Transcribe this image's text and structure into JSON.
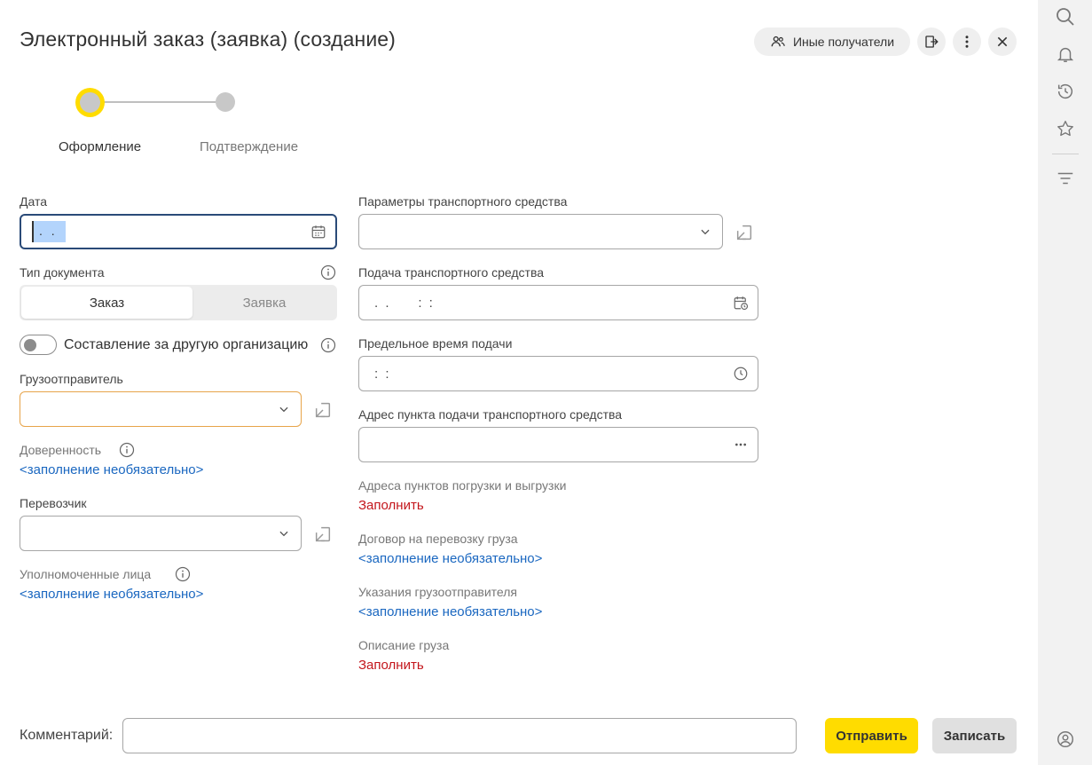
{
  "header": {
    "title": "Электронный заказ (заявка) (создание)",
    "other_recipients": "Иные получатели"
  },
  "steps": [
    {
      "label": "Оформление",
      "active": true
    },
    {
      "label": "Подтверждение",
      "active": false
    }
  ],
  "left": {
    "date_label": "Дата",
    "date_value": ". .",
    "doc_type_label": "Тип документа",
    "doc_type_options": [
      "Заказ",
      "Заявка"
    ],
    "doc_type_selected": "Заказ",
    "other_org_label": "Составление за другую организацию",
    "shipper_label": "Грузоотправитель",
    "power_of_attorney_label": "Доверенность",
    "power_of_attorney_link": "<заполнение необязательно>",
    "carrier_label": "Перевозчик",
    "authorized_label": "Уполномоченные лица",
    "authorized_link": "<заполнение необязательно>"
  },
  "right": {
    "vehicle_params_label": "Параметры транспортного средства",
    "vehicle_supply_label": "Подача транспортного средства",
    "vehicle_supply_value": ". .     : :",
    "deadline_label": "Предельное время подачи",
    "deadline_value": ": :",
    "supply_address_label": "Адрес пункта подачи транспортного средства",
    "loading_addresses_label": "Адреса пунктов погрузки и выгрузки",
    "loading_addresses_link": "Заполнить",
    "contract_label": "Договор на перевозку груза",
    "contract_link": "<заполнение необязательно>",
    "shipper_instructions_label": "Указания грузоотправителя",
    "shipper_instructions_link": "<заполнение необязательно>",
    "cargo_description_label": "Описание груза",
    "cargo_description_link": "Заполнить"
  },
  "footer": {
    "comment_label": "Комментарий:",
    "comment_value": "",
    "send_label": "Отправить",
    "save_label": "Записать"
  },
  "colors": {
    "accent_yellow": "#ffdc00",
    "link_blue": "#1a67c0",
    "link_red": "#c3151b",
    "focus_border": "#2a4a78",
    "warn_border": "#e7a44a"
  }
}
